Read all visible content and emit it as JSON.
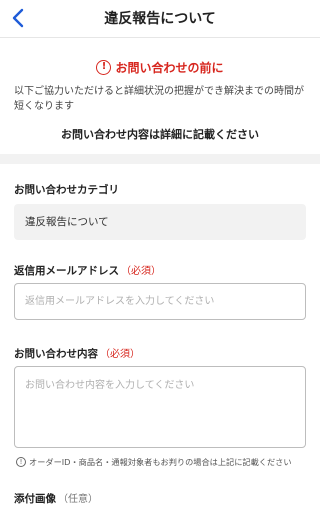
{
  "header": {
    "title": "違反報告について",
    "back_icon": "chevron-left-icon",
    "accent": "#1e5bd8"
  },
  "notice": {
    "heading": "お問い合わせの前に",
    "icon": "exclamation-circle-icon",
    "body": "以下ご協力いただけると詳細状況の把握ができ解決までの時間が短くなります",
    "strong": "お問い合わせ内容は詳細に記載ください",
    "color": "#d7261e"
  },
  "form": {
    "category": {
      "label": "お問い合わせカテゴリ",
      "value": "違反報告について"
    },
    "email": {
      "label": "返信用メールアドレス",
      "required": "（必須）",
      "placeholder": "返信用メールアドレスを入力してください",
      "value": ""
    },
    "content": {
      "label": "お問い合わせ内容",
      "required": "（必須）",
      "placeholder": "お問い合わせ内容を入力してください",
      "value": ""
    },
    "hint": {
      "icon": "exclamation-circle-icon",
      "text": "オーダーID・商品名・通報対象者もお判りの場合は上記に記載ください"
    },
    "attachment": {
      "label": "添付画像",
      "optional": "（任意）"
    }
  }
}
